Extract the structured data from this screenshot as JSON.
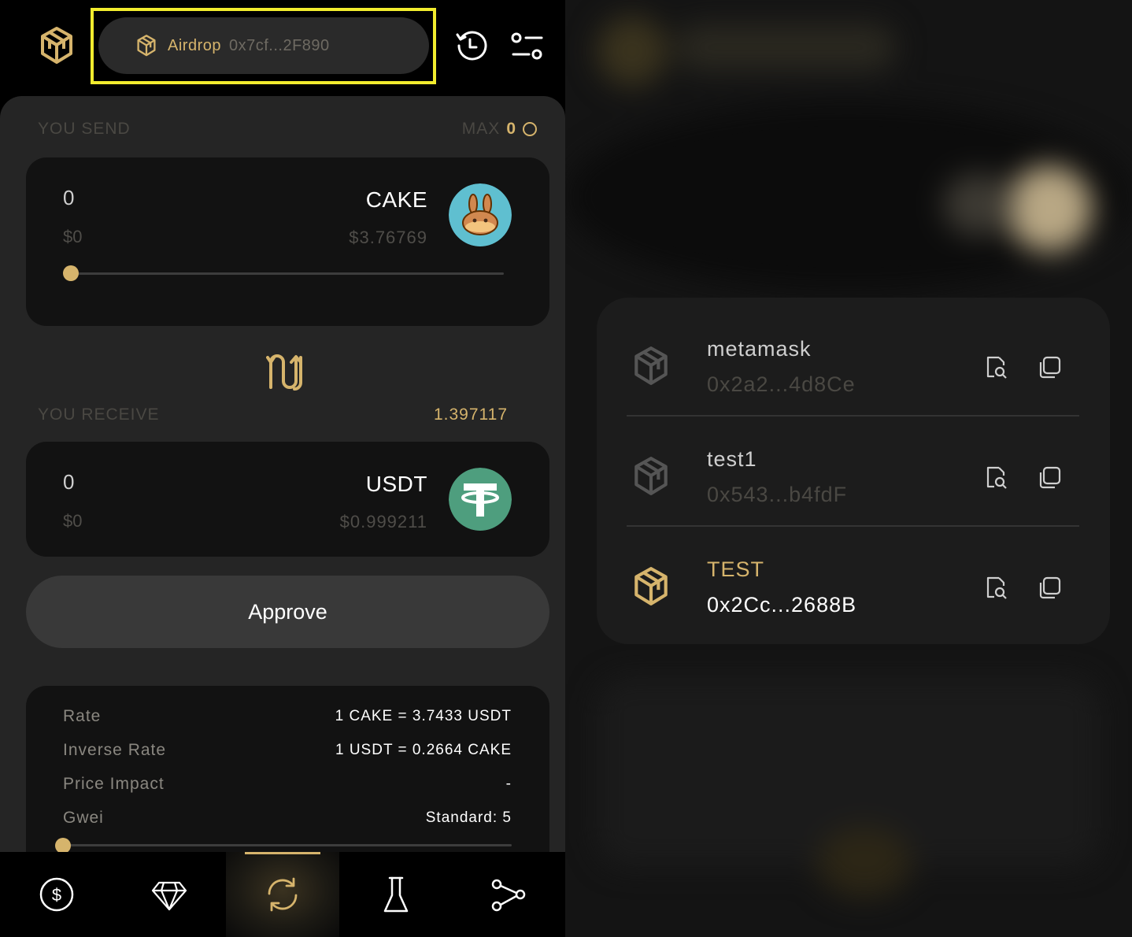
{
  "header": {
    "account_name": "Airdrop",
    "account_address": "0x7cf...2F890"
  },
  "send": {
    "label": "YOU SEND",
    "max_label": "MAX",
    "max_value": "0",
    "amount": "0",
    "amount_usd": "$0",
    "symbol": "CAKE",
    "price_usd": "$3.76769",
    "slider_fraction": 0
  },
  "receive": {
    "label": "YOU RECEIVE",
    "value": "1.397117",
    "amount": "0",
    "amount_usd": "$0",
    "symbol": "USDT",
    "price_usd": "$0.999211"
  },
  "approve_label": "Approve",
  "info": {
    "rows": [
      {
        "key": "Rate",
        "value": "1 CAKE = 3.7433 USDT"
      },
      {
        "key": "Inverse Rate",
        "value": "1 USDT = 0.2664 CAKE"
      },
      {
        "key": "Price Impact",
        "value": "-"
      },
      {
        "key": "Gwei",
        "value": "Standard: 5"
      }
    ],
    "gwei_slider_fraction": 0
  },
  "nav": {
    "items": [
      "dollar-icon",
      "diamond-icon",
      "swap-icon",
      "flask-icon",
      "share-icon"
    ],
    "active": "swap-icon"
  },
  "accounts": [
    {
      "name": "metamask",
      "address": "0x2a2...4d8Ce",
      "active": false
    },
    {
      "name": "test1",
      "address": "0x543...b4fdF",
      "active": false
    },
    {
      "name": "TEST",
      "address": "0x2Cc...2688B",
      "active": true
    }
  ],
  "colors": {
    "accent": "#d6b46c",
    "highlight_box": "#f2ec2e",
    "cake_bg": "#5fbfd0",
    "usdt_bg": "#4e9e7e"
  }
}
